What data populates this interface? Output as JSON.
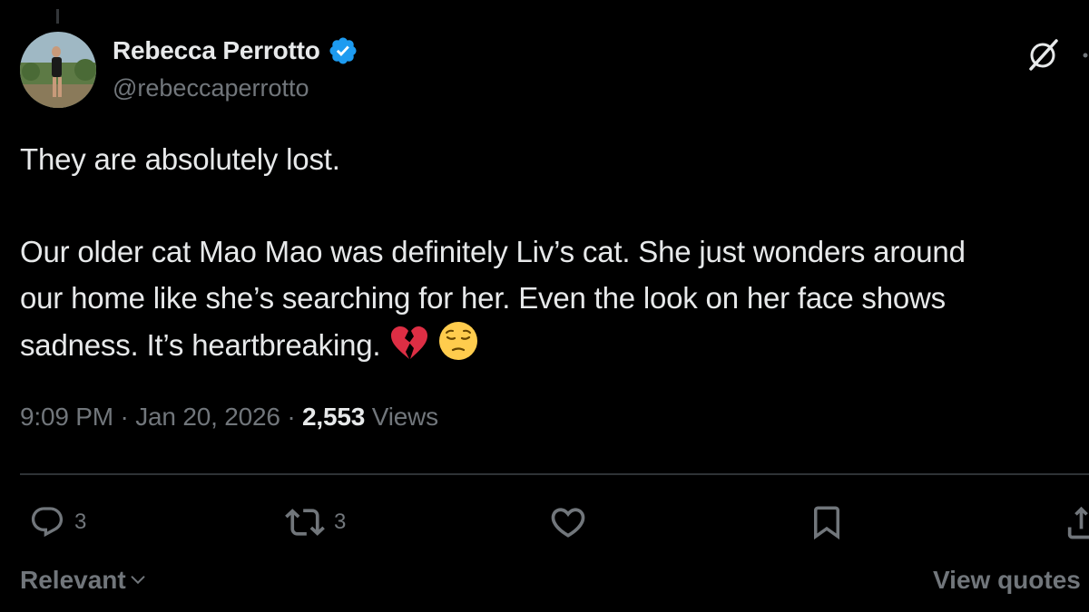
{
  "author": {
    "display_name": "Rebecca Perrotto",
    "handle": "@rebeccaperrotto",
    "verified": true,
    "avatar_icon": "profile-photo"
  },
  "tweet": {
    "line1": "They are absolutely lost.",
    "para2_line1": "Our older cat Mao Mao was definitely Liv’s cat. She just wonders around",
    "para2_line2": "our home like she’s searching for her. Even the look on her face shows",
    "para2_line3": "sadness. It’s heartbreaking.",
    "emojis": [
      "broken-heart",
      "pensive-face"
    ]
  },
  "meta": {
    "time": "9:09 PM",
    "separator": "·",
    "date": "Jan 20, 2026",
    "views_count": "2,553",
    "views_label": "Views"
  },
  "actions": {
    "replies": "3",
    "reposts": "3"
  },
  "footer": {
    "sort_label": "Relevant",
    "view_quotes": "View quotes"
  },
  "colors": {
    "background": "#000000",
    "primary_text": "#e7e9ea",
    "secondary_text": "#71767b",
    "verified_blue": "#1d9bf0",
    "divider": "#2f3336"
  }
}
